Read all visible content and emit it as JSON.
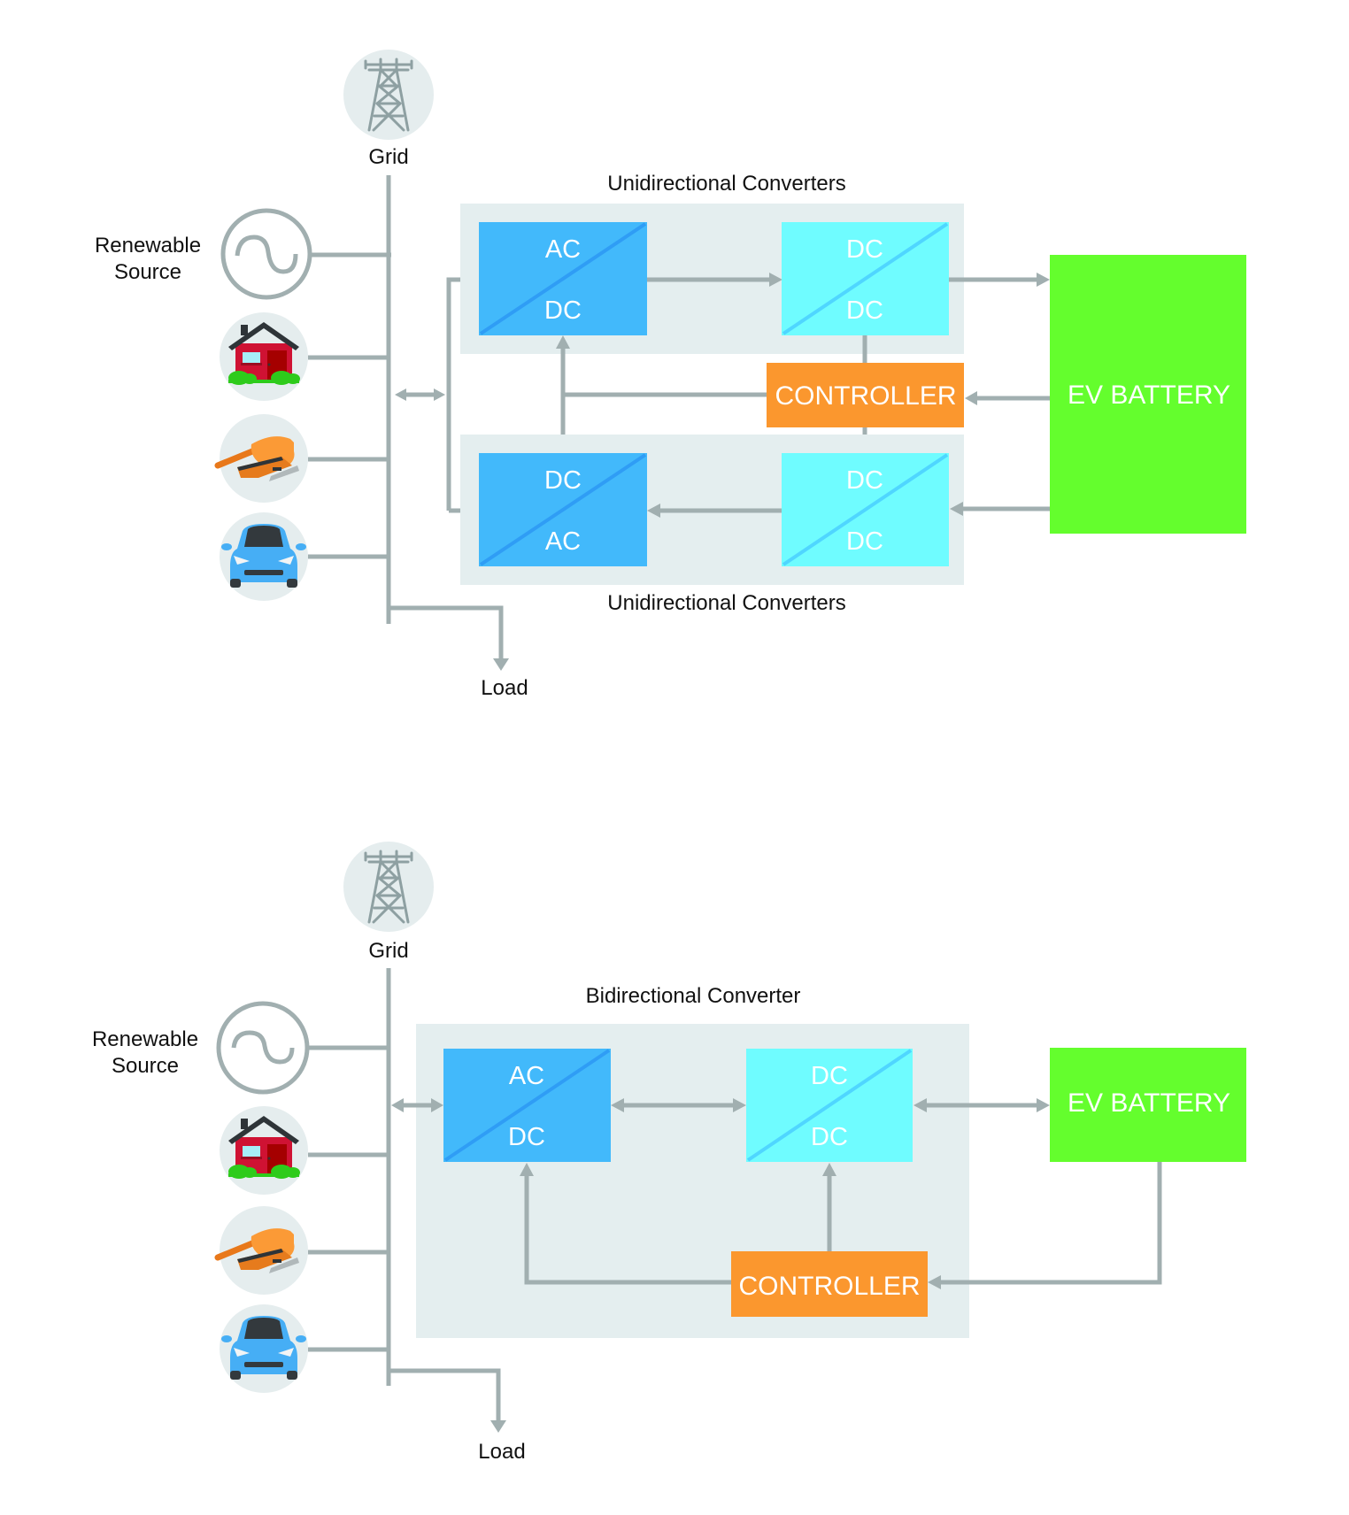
{
  "colors": {
    "ac_dc_box": "#42b9fb",
    "ac_dc_diag": "#2f9df5",
    "dc_dc_box": "#6ffcff",
    "dc_dc_diag": "#4fd6ff",
    "controller": "#fb972e",
    "battery": "#64fe2d",
    "wire": "#a1afb0",
    "panel": "#e4eeef"
  },
  "top_diagram": {
    "grid_label": "Grid",
    "renewable_label_line1": "Renewable",
    "renewable_label_line2": "Source",
    "load_label": "Load",
    "upper_panel_title": "Unidirectional Converters",
    "lower_panel_title": "Unidirectional Converters",
    "upper_left_box": {
      "top": "AC",
      "bottom": "DC"
    },
    "upper_right_box": {
      "top": "DC",
      "bottom": "DC"
    },
    "lower_left_box": {
      "top": "DC",
      "bottom": "AC"
    },
    "lower_right_box": {
      "top": "DC",
      "bottom": "DC"
    },
    "controller_label": "CONTROLLER",
    "battery_label": "EV BATTERY",
    "loads": [
      "renewable-source-icon",
      "house-icon",
      "sander-icon",
      "car-icon"
    ]
  },
  "bottom_diagram": {
    "grid_label": "Grid",
    "renewable_label_line1": "Renewable",
    "renewable_label_line2": "Source",
    "load_label": "Load",
    "panel_title": "Bidirectional Converter",
    "left_box": {
      "top": "AC",
      "bottom": "DC"
    },
    "right_box": {
      "top": "DC",
      "bottom": "DC"
    },
    "controller_label": "CONTROLLER",
    "battery_label": "EV BATTERY",
    "loads": [
      "renewable-source-icon",
      "house-icon",
      "sander-icon",
      "car-icon"
    ]
  }
}
